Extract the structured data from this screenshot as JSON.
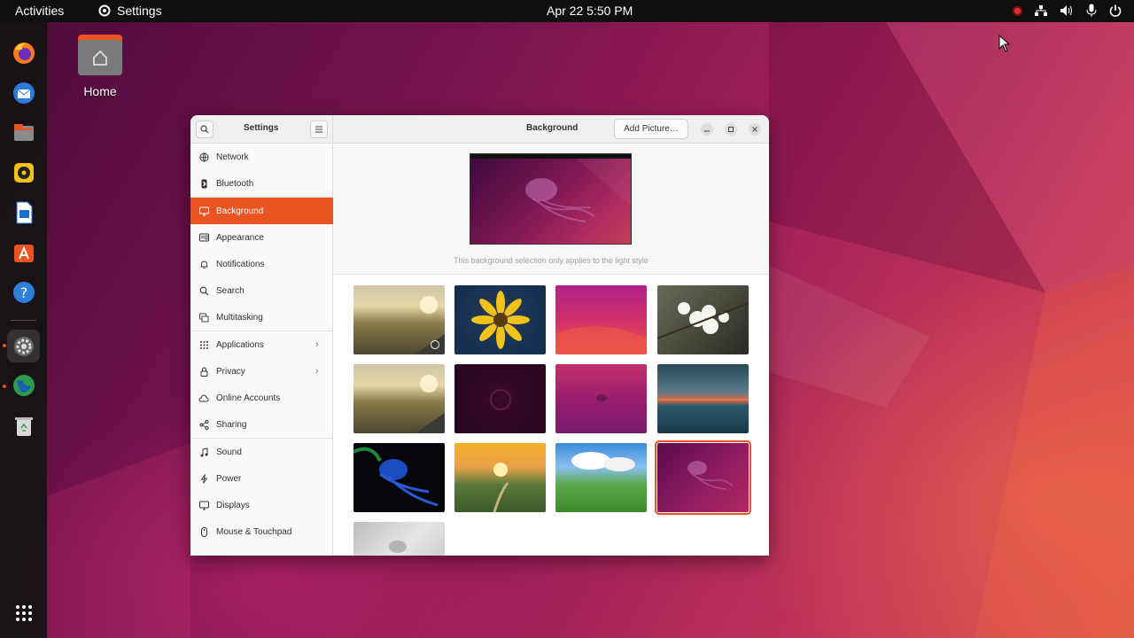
{
  "topbar": {
    "activities": "Activities",
    "app_name": "Settings",
    "clock": "Apr 22  5:50 PM"
  },
  "desktop": {
    "home_label": "Home"
  },
  "dock": {
    "items": [
      "firefox-icon",
      "thunderbird-icon",
      "files-icon",
      "rhythmbox-icon",
      "writer-icon",
      "app-center-icon",
      "help-icon",
      "settings-icon",
      "globe-icon",
      "trash-icon",
      "app-grid-icon"
    ]
  },
  "window": {
    "sidebar_title": "Settings",
    "page_title": "Background",
    "add_picture": "Add Picture…",
    "preview_note": "This background selection only applies to the light style"
  },
  "sidebar": {
    "items": [
      {
        "label": "Network",
        "icon": "globe-icon"
      },
      {
        "label": "Bluetooth",
        "icon": "bluetooth-icon"
      },
      {
        "label": "Background",
        "icon": "display-icon",
        "selected": true
      },
      {
        "label": "Appearance",
        "icon": "appearance-icon"
      },
      {
        "label": "Notifications",
        "icon": "bell-icon"
      },
      {
        "label": "Search",
        "icon": "search-icon"
      },
      {
        "label": "Multitasking",
        "icon": "multitasking-icon"
      },
      {
        "label": "Applications",
        "icon": "apps-icon",
        "chevron": true
      },
      {
        "label": "Privacy",
        "icon": "lock-icon",
        "chevron": true
      },
      {
        "label": "Online Accounts",
        "icon": "cloud-icon"
      },
      {
        "label": "Sharing",
        "icon": "share-icon"
      },
      {
        "label": "Sound",
        "icon": "music-note-icon"
      },
      {
        "label": "Power",
        "icon": "power-icon"
      },
      {
        "label": "Displays",
        "icon": "monitor-icon"
      },
      {
        "label": "Mouse & Touchpad",
        "icon": "mouse-icon"
      }
    ]
  },
  "colors": {
    "accent": "#e95420",
    "topbar": "#0f0f0f"
  }
}
